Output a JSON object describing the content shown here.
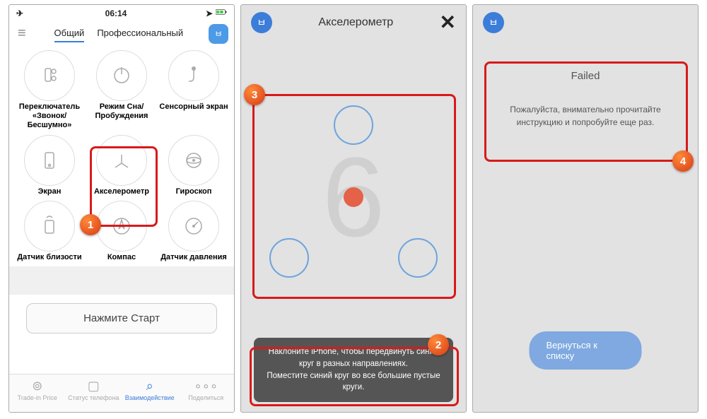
{
  "status": {
    "time": "06:14"
  },
  "tabs": {
    "general": "Общий",
    "pro": "Профессиональный"
  },
  "tests": {
    "r1c1": "Переключатель «Звонок/Бесшумно»",
    "r1c2": "Режим Сна/Пробуждения",
    "r1c3": "Сенсорный экран",
    "r2c1": "Экран",
    "r2c2": "Акселерометр",
    "r2c3": "Гироскоп",
    "r3c1": "Датчик близости",
    "r3c2": "Компас",
    "r3c3": "Датчик давления"
  },
  "start_btn": "Нажмите Старт",
  "bottom": {
    "trade": "Trade-in Price",
    "status": "Статус телефона",
    "interact": "Взаимодействие",
    "share": "Поделиться"
  },
  "p2": {
    "title": "Акселерометр",
    "countdown": "6",
    "instructions": "Наклоните iPhone, чтобы передвинуть синий круг в разных направлениях.\nПоместите синий круг во все большие пустые круги."
  },
  "p3": {
    "title": "Failed",
    "message": "Пожалуйста, внимательно прочитайте инструкцию и попробуйте еще раз.",
    "back": "Вернуться к списку"
  }
}
